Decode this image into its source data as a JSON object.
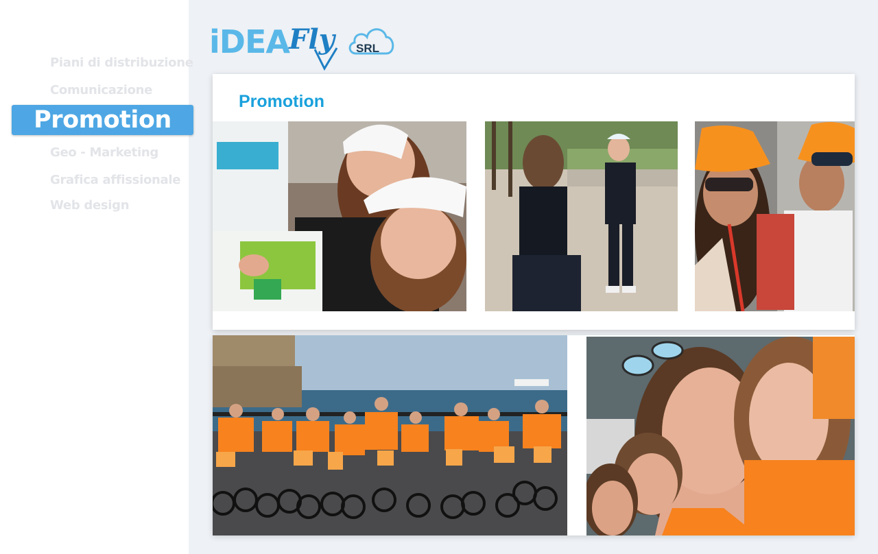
{
  "brand": {
    "logo_idea": "iDEA",
    "logo_fly": "Fly",
    "logo_srl": "SRL"
  },
  "sidebar": {
    "items": [
      {
        "label": "Piani di distribuzione"
      },
      {
        "label": "Comunicazione"
      },
      {
        "label": "Promotion",
        "active": true
      },
      {
        "label": "Geo - Marketing"
      },
      {
        "label": "Grafica affissionale"
      },
      {
        "label": "Web design"
      }
    ]
  },
  "section": {
    "title": "Promotion"
  },
  "colors": {
    "accent": "#4ea7e4",
    "title": "#1aa1dc",
    "logo_light": "#5ab8e8",
    "logo_dark": "#1f7fc4",
    "uniform_orange": "#f7821e"
  }
}
